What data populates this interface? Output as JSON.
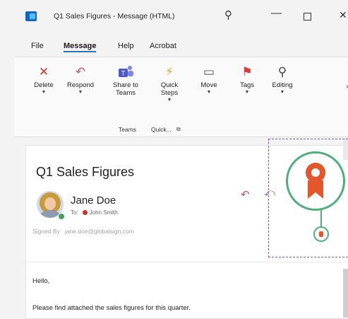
{
  "window": {
    "title": "Q1 Sales Figures  -  Message (HTML)"
  },
  "menu": [
    {
      "label": "File",
      "active": false
    },
    {
      "label": "Message",
      "active": true
    },
    {
      "label": "Help",
      "active": false
    },
    {
      "label": "Acrobat",
      "active": false
    }
  ],
  "ribbon": {
    "buttons": [
      {
        "label": "Delete",
        "icon": "delete-x-icon",
        "dropdown": true
      },
      {
        "label": "Respond",
        "icon": "reply-arrow-icon",
        "dropdown": true
      },
      {
        "label": "Share to Teams",
        "icon": "teams-icon",
        "dropdown": false
      },
      {
        "label": "Quick Steps",
        "icon": "lightning-icon",
        "dropdown": true
      },
      {
        "label": "Move",
        "icon": "folder-move-icon",
        "dropdown": true
      },
      {
        "label": "Tags",
        "icon": "flag-icon",
        "dropdown": true
      },
      {
        "label": "Editing",
        "icon": "search-icon",
        "dropdown": true
      }
    ],
    "groups": [
      {
        "label": "Teams"
      },
      {
        "label": "Quick..."
      }
    ]
  },
  "message": {
    "subject": "Q1 Sales Figures",
    "sender": "Jane Doe",
    "to_prefix": "To:",
    "recipient": "John Smith",
    "signed_by_label": "Signed By",
    "signed_by_email": "jane.doe@globalsign.com",
    "body": [
      "Hello,",
      "Please find attached the sales figures for this quarter."
    ]
  },
  "colors": {
    "accent": "#2f6fbd",
    "badge_green": "#4fae7a",
    "badge_orange": "#e2572b",
    "selection_dash": "#7b5ea7",
    "delete_red": "#d13438",
    "tags_red": "#d83b3b"
  }
}
